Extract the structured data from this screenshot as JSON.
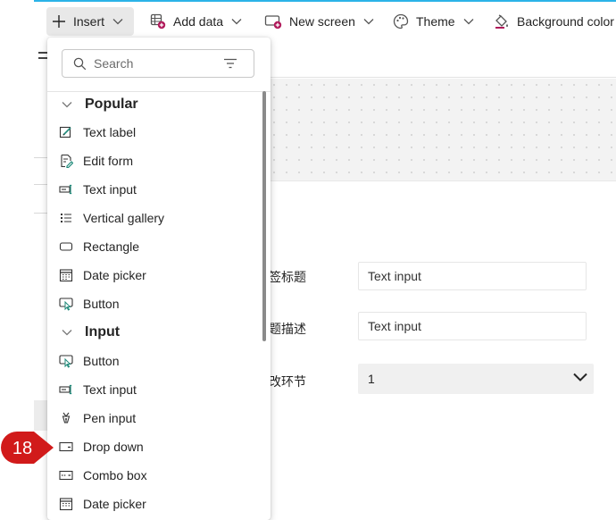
{
  "toolbar": {
    "insert": "Insert",
    "add_data": "Add data",
    "new_screen": "New screen",
    "theme": "Theme",
    "background_color": "Background color"
  },
  "panel": {
    "search_placeholder": "Search",
    "sections": [
      {
        "title": "Popular",
        "items": [
          {
            "label": "Text label",
            "icon": "text-label-icon"
          },
          {
            "label": "Edit form",
            "icon": "edit-form-icon"
          },
          {
            "label": "Text input",
            "icon": "text-input-icon"
          },
          {
            "label": "Vertical gallery",
            "icon": "vertical-gallery-icon"
          },
          {
            "label": "Rectangle",
            "icon": "rectangle-icon"
          },
          {
            "label": "Date picker",
            "icon": "calendar-icon"
          },
          {
            "label": "Button",
            "icon": "button-icon"
          }
        ]
      },
      {
        "title": "Input",
        "items": [
          {
            "label": "Button",
            "icon": "button-icon"
          },
          {
            "label": "Text input",
            "icon": "text-input-icon"
          },
          {
            "label": "Pen input",
            "icon": "pen-icon"
          },
          {
            "label": "Drop down",
            "icon": "dropdown-icon"
          },
          {
            "label": "Combo box",
            "icon": "combo-box-icon"
          },
          {
            "label": "Date picker",
            "icon": "calendar-icon"
          }
        ]
      }
    ]
  },
  "form": {
    "rows": [
      {
        "label": "签标题",
        "value": "Text input"
      },
      {
        "label": "题描述",
        "value": "Text input"
      },
      {
        "label": "改环节",
        "value": "1"
      }
    ]
  },
  "step_badge": "18",
  "colors": {
    "accent": "#2bb3e8",
    "badge": "#d11a1a"
  }
}
